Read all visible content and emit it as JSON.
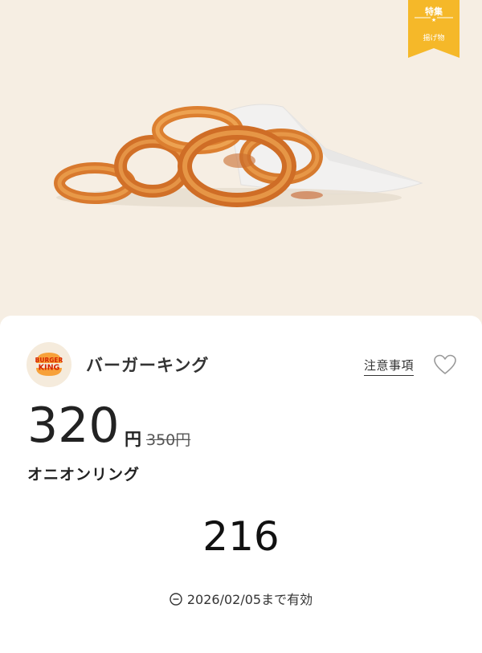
{
  "ribbon": {
    "top_label": "特集",
    "star": "★",
    "bottom_label": "揚げ物",
    "color": "#f5b829"
  },
  "hero": {
    "image": "onion-rings-photo",
    "background": "#f6eee3"
  },
  "store": {
    "name": "バーガーキング",
    "logo_text_top": "BURGER",
    "logo_text_bottom": "KING"
  },
  "actions": {
    "notes_label": "注意事項",
    "favorite_icon": "heart-outline-icon"
  },
  "offer": {
    "price": "320",
    "currency": "円",
    "original_price": "350円",
    "item_name": "オニオンリング",
    "coupon_code": "216",
    "validity_text": "2026/02/05まで有効",
    "validity_icon": "clock-minus-icon"
  }
}
